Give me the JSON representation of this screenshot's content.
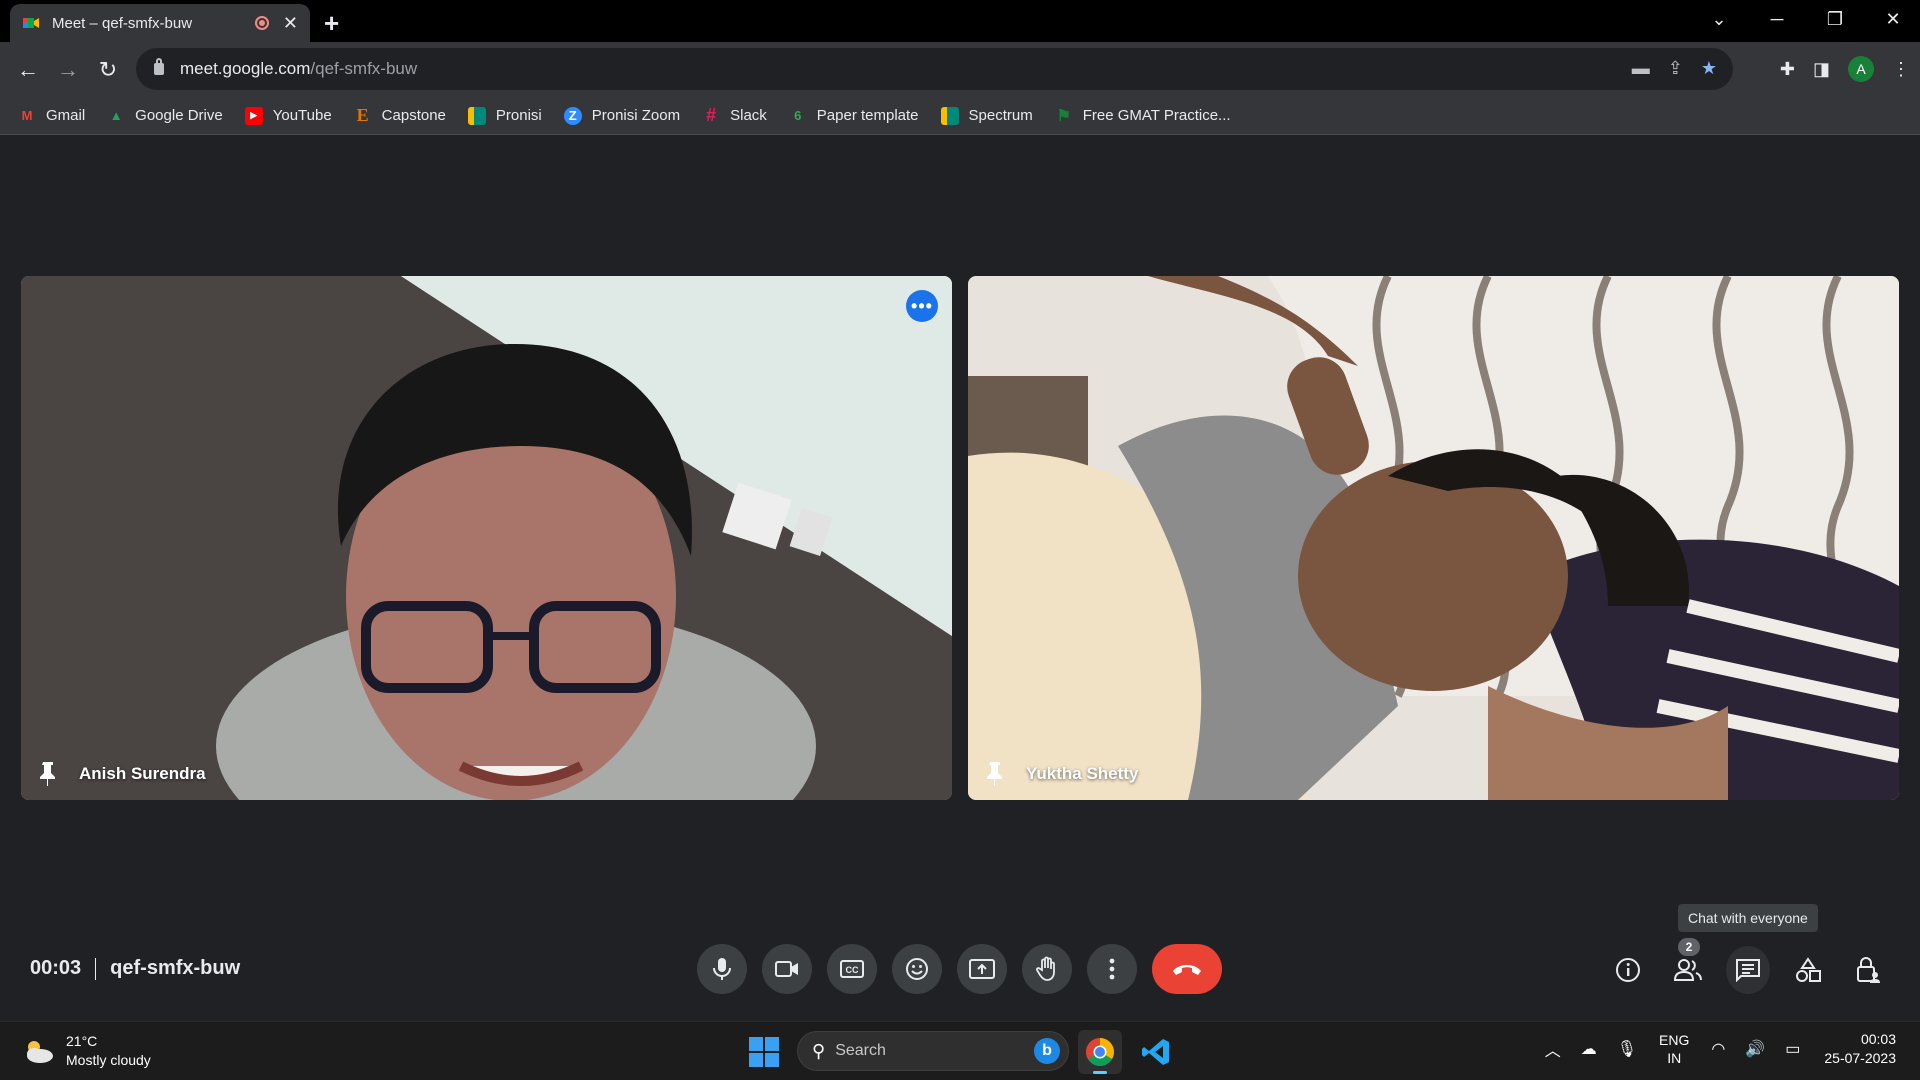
{
  "browser": {
    "tab_title": "Meet – qef-smfx-buw",
    "url_host": "meet.google.com",
    "url_path": "/qef-smfx-buw",
    "profile_initial": "A"
  },
  "bookmarks": [
    {
      "label": "Gmail",
      "icon": "gmail-icon",
      "color": "#ea4335",
      "glyph": "M"
    },
    {
      "label": "Google Drive",
      "icon": "google-drive-icon",
      "color": "#1fa463",
      "glyph": "▲"
    },
    {
      "label": "YouTube",
      "icon": "youtube-icon",
      "color": "#ff0000",
      "glyph": "▶"
    },
    {
      "label": "Capstone",
      "icon": "capstone-icon",
      "color": "#e37400",
      "glyph": "E"
    },
    {
      "label": "Pronisi",
      "icon": "meet-icon",
      "color": "#00897b",
      "glyph": "■"
    },
    {
      "label": "Pronisi Zoom",
      "icon": "zoom-icon",
      "color": "#2d8cff",
      "glyph": "Z"
    },
    {
      "label": "Slack",
      "icon": "slack-icon",
      "color": "#611f69",
      "glyph": "#"
    },
    {
      "label": "Paper template",
      "icon": "paper-template-icon",
      "color": "#34a853",
      "glyph": "6"
    },
    {
      "label": "Spectrum",
      "icon": "meet-icon",
      "color": "#00897b",
      "glyph": "■"
    },
    {
      "label": "Free GMAT Practice...",
      "icon": "gmat-icon",
      "color": "#188038",
      "glyph": "G"
    }
  ],
  "participants": [
    {
      "name": "Anish Surendra"
    },
    {
      "name": "Yuktha Shetty"
    }
  ],
  "meeting": {
    "time": "00:03",
    "code": "qef-smfx-buw",
    "participant_count": "2",
    "tooltip": "Chat with everyone"
  },
  "taskbar": {
    "temperature": "21°C",
    "weather_desc": "Mostly cloudy",
    "search_placeholder": "Search",
    "lang_top": "ENG",
    "lang_bottom": "IN",
    "time": "00:03",
    "date": "25-07-2023"
  }
}
